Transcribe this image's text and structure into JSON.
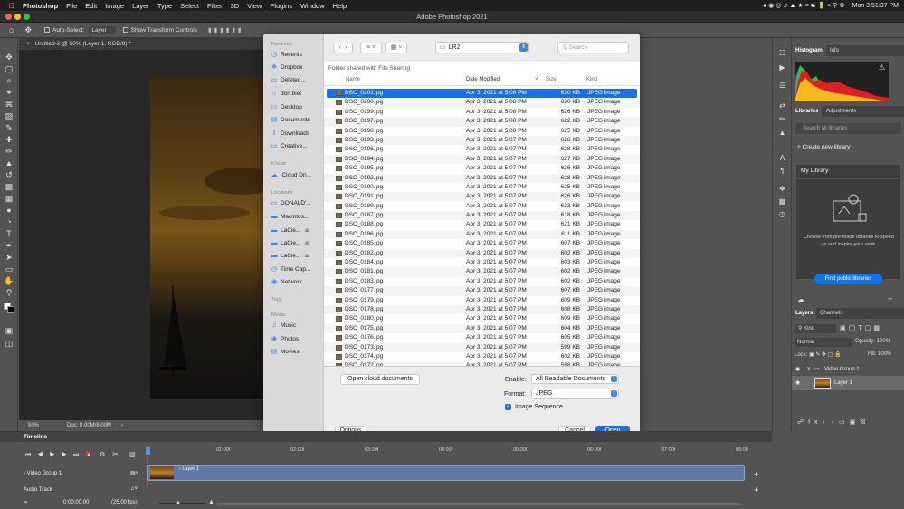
{
  "menubar": {
    "app": "Photoshop",
    "items": [
      "File",
      "Edit",
      "Image",
      "Layer",
      "Type",
      "Select",
      "Filter",
      "3D",
      "View",
      "Plugins",
      "Window",
      "Help"
    ],
    "clock": "Mon 3:51:37 PM"
  },
  "window": {
    "title": "Adobe Photoshop 2021"
  },
  "options": {
    "auto_select": "Auto-Select:",
    "auto_select_value": "Layer",
    "transform": "Show Transform Controls"
  },
  "document": {
    "tab": "Untitled-2 @ 50% (Layer 1, RGB/8) *",
    "zoom": "50%",
    "doc_info": "Doc: 8.00M/8.00M"
  },
  "dialog": {
    "sidebar": {
      "favorites_head": "Favorites",
      "favorites": [
        "Recents",
        "Dropbox",
        "Deleted...",
        "don.biel",
        "Desktop",
        "Documents",
        "Downloads",
        "Creative..."
      ],
      "icloud_head": "iCloud",
      "icloud": [
        "iCloud Dri..."
      ],
      "locations_head": "Locations",
      "locations": [
        "DONALD'...",
        "Macintos...",
        "LaCie...",
        "LaCie...",
        "LaCie...",
        "Time Cap...",
        "Network"
      ],
      "tags_head": "Tags",
      "media_head": "Media",
      "media": [
        "Music",
        "Photos",
        "Movies"
      ]
    },
    "folder": "LR2",
    "search_placeholder": "Search",
    "shared_label": "Folder shared with File Sharing",
    "columns": {
      "name": "Name",
      "date": "Date Modified",
      "size": "Size",
      "kind": "Kind"
    },
    "files": [
      {
        "name": "DSC_0201.jpg",
        "date": "Apr 3, 2021 at 5:08 PM",
        "size": "630 KB",
        "kind": "JPEG image"
      },
      {
        "name": "DSC_0200.jpg",
        "date": "Apr 3, 2021 at 5:08 PM",
        "size": "630 KB",
        "kind": "JPEG image"
      },
      {
        "name": "DSC_0199.jpg",
        "date": "Apr 3, 2021 at 5:08 PM",
        "size": "626 KB",
        "kind": "JPEG image"
      },
      {
        "name": "DSC_0197.jpg",
        "date": "Apr 3, 2021 at 5:08 PM",
        "size": "622 KB",
        "kind": "JPEG image"
      },
      {
        "name": "DSC_0198.jpg",
        "date": "Apr 3, 2021 at 5:08 PM",
        "size": "625 KB",
        "kind": "JPEG image"
      },
      {
        "name": "DSC_0193.jpg",
        "date": "Apr 3, 2021 at 5:07 PM",
        "size": "626 KB",
        "kind": "JPEG image"
      },
      {
        "name": "DSC_0196.jpg",
        "date": "Apr 3, 2021 at 5:07 PM",
        "size": "628 KB",
        "kind": "JPEG image"
      },
      {
        "name": "DSC_0194.jpg",
        "date": "Apr 3, 2021 at 5:07 PM",
        "size": "627 KB",
        "kind": "JPEG image"
      },
      {
        "name": "DSC_0195.jpg",
        "date": "Apr 3, 2021 at 5:07 PM",
        "size": "626 KB",
        "kind": "JPEG image"
      },
      {
        "name": "DSC_0192.jpg",
        "date": "Apr 3, 2021 at 5:07 PM",
        "size": "628 KB",
        "kind": "JPEG image"
      },
      {
        "name": "DSC_0190.jpg",
        "date": "Apr 3, 2021 at 5:07 PM",
        "size": "625 KB",
        "kind": "JPEG image"
      },
      {
        "name": "DSC_0191.jpg",
        "date": "Apr 3, 2021 at 5:07 PM",
        "size": "626 KB",
        "kind": "JPEG image"
      },
      {
        "name": "DSC_0189.jpg",
        "date": "Apr 3, 2021 at 5:07 PM",
        "size": "623 KB",
        "kind": "JPEG image"
      },
      {
        "name": "DSC_0187.jpg",
        "date": "Apr 3, 2021 at 5:07 PM",
        "size": "618 KB",
        "kind": "JPEG image"
      },
      {
        "name": "DSC_0188.jpg",
        "date": "Apr 3, 2021 at 5:07 PM",
        "size": "621 KB",
        "kind": "JPEG image"
      },
      {
        "name": "DSC_0186.jpg",
        "date": "Apr 3, 2021 at 5:07 PM",
        "size": "611 KB",
        "kind": "JPEG image"
      },
      {
        "name": "DSC_0185.jpg",
        "date": "Apr 3, 2021 at 5:07 PM",
        "size": "607 KB",
        "kind": "JPEG image"
      },
      {
        "name": "DSC_0182.jpg",
        "date": "Apr 3, 2021 at 5:07 PM",
        "size": "602 KB",
        "kind": "JPEG image"
      },
      {
        "name": "DSC_0184.jpg",
        "date": "Apr 3, 2021 at 5:07 PM",
        "size": "603 KB",
        "kind": "JPEG image"
      },
      {
        "name": "DSC_0181.jpg",
        "date": "Apr 3, 2021 at 5:07 PM",
        "size": "602 KB",
        "kind": "JPEG image"
      },
      {
        "name": "DSC_0183.jpg",
        "date": "Apr 3, 2021 at 5:07 PM",
        "size": "602 KB",
        "kind": "JPEG image"
      },
      {
        "name": "DSC_0177.jpg",
        "date": "Apr 3, 2021 at 5:07 PM",
        "size": "607 KB",
        "kind": "JPEG image"
      },
      {
        "name": "DSC_0179.jpg",
        "date": "Apr 3, 2021 at 5:07 PM",
        "size": "609 KB",
        "kind": "JPEG image"
      },
      {
        "name": "DSC_0178.jpg",
        "date": "Apr 3, 2021 at 5:07 PM",
        "size": "608 KB",
        "kind": "JPEG image"
      },
      {
        "name": "DSC_0180.jpg",
        "date": "Apr 3, 2021 at 5:07 PM",
        "size": "609 KB",
        "kind": "JPEG image"
      },
      {
        "name": "DSC_0175.jpg",
        "date": "Apr 3, 2021 at 5:07 PM",
        "size": "604 KB",
        "kind": "JPEG image"
      },
      {
        "name": "DSC_0176.jpg",
        "date": "Apr 3, 2021 at 5:07 PM",
        "size": "605 KB",
        "kind": "JPEG image"
      },
      {
        "name": "DSC_0173.jpg",
        "date": "Apr 3, 2021 at 5:07 PM",
        "size": "599 KB",
        "kind": "JPEG image"
      },
      {
        "name": "DSC_0174.jpg",
        "date": "Apr 3, 2021 at 5:07 PM",
        "size": "602 KB",
        "kind": "JPEG image"
      },
      {
        "name": "DSC_0172.jpg",
        "date": "Apr 3, 2021 at 5:07 PM",
        "size": "598 KB",
        "kind": "JPEG image"
      }
    ],
    "open_cloud": "Open cloud documents",
    "enable_label": "Enable:",
    "enable_value": "All Readable Documents",
    "format_label": "Format:",
    "format_value": "JPEG",
    "image_sequence": "Image Sequence",
    "options_btn": "Options",
    "cancel_btn": "Cancel",
    "open_btn": "Open"
  },
  "panels": {
    "histogram_tab": "Histogram",
    "info_tab": "Info",
    "libraries_tab": "Libraries",
    "adjustments_tab": "Adjustments",
    "lib_search": "Search all libraries",
    "create_lib": "Create new library",
    "my_library": "My Library",
    "lib_text": "Choose from pre-made libraries to speed up and inspire your work.",
    "find_lib": "Find public libraries",
    "layers_tab": "Layers",
    "channels_tab": "Channels",
    "kind": "Kind",
    "blend": "Normal",
    "opacity_label": "Opacity:",
    "opacity": "100%",
    "lock_label": "Lock:",
    "fill_label": "Fill:",
    "fill": "100%",
    "group_name": "Video Group 1",
    "layer_name": "Layer 1"
  },
  "timeline": {
    "title": "Timeline",
    "ruler": [
      "01:00f",
      "02:00f",
      "03:00f",
      "04:00f",
      "05:00f",
      "06:00f",
      "07:00f",
      "08:00"
    ],
    "video_group": "Video Group 1",
    "audio_track": "Audio Track",
    "clip_label": "Layer 1",
    "timecode": "0:00:00:00",
    "fps": "(25.00 fps)"
  }
}
